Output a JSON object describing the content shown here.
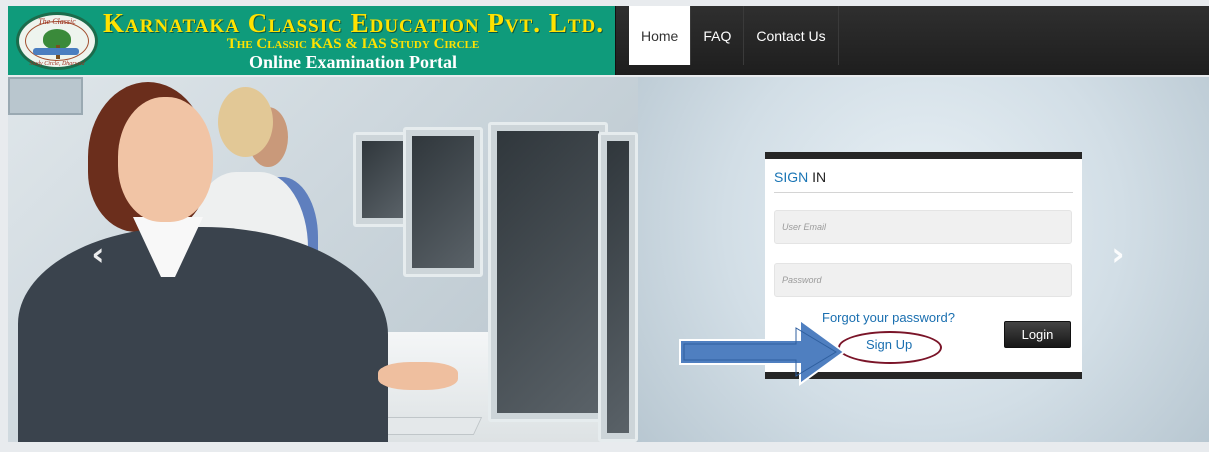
{
  "header": {
    "brand_title": "Karnataka Classic Education Pvt. Ltd.",
    "brand_subtitle": "The Classic KAS & IAS Study Circle",
    "brand_portal": "Online Examination Portal",
    "logo_icon": "palm-tree-logo-icon",
    "logo_text_top": "The Classic",
    "logo_text_bottom": "Study Circle, Dharwad"
  },
  "nav": {
    "items": [
      {
        "label": "Home",
        "active": true
      },
      {
        "label": "FAQ",
        "active": false
      },
      {
        "label": "Contact Us",
        "active": false
      }
    ]
  },
  "carousel": {
    "prev_icon": "chevron-left-icon",
    "next_icon": "chevron-right-icon",
    "prev_glyph": "‹",
    "next_glyph": "›"
  },
  "signin": {
    "title_accent": "SIGN",
    "title_rest": " IN",
    "email_placeholder": "User Email",
    "password_placeholder": "Password",
    "forgot_label": "Forgot your password?",
    "signup_label": "Sign Up",
    "login_label": "Login"
  },
  "colors": {
    "brand_green": "#0f9b7b",
    "brand_yellow": "#ffe200",
    "nav_dark": "#262626",
    "link_blue": "#1a6fb0",
    "highlight_ring": "#7a1428",
    "annotation_arrow": "#4f7fc0"
  }
}
